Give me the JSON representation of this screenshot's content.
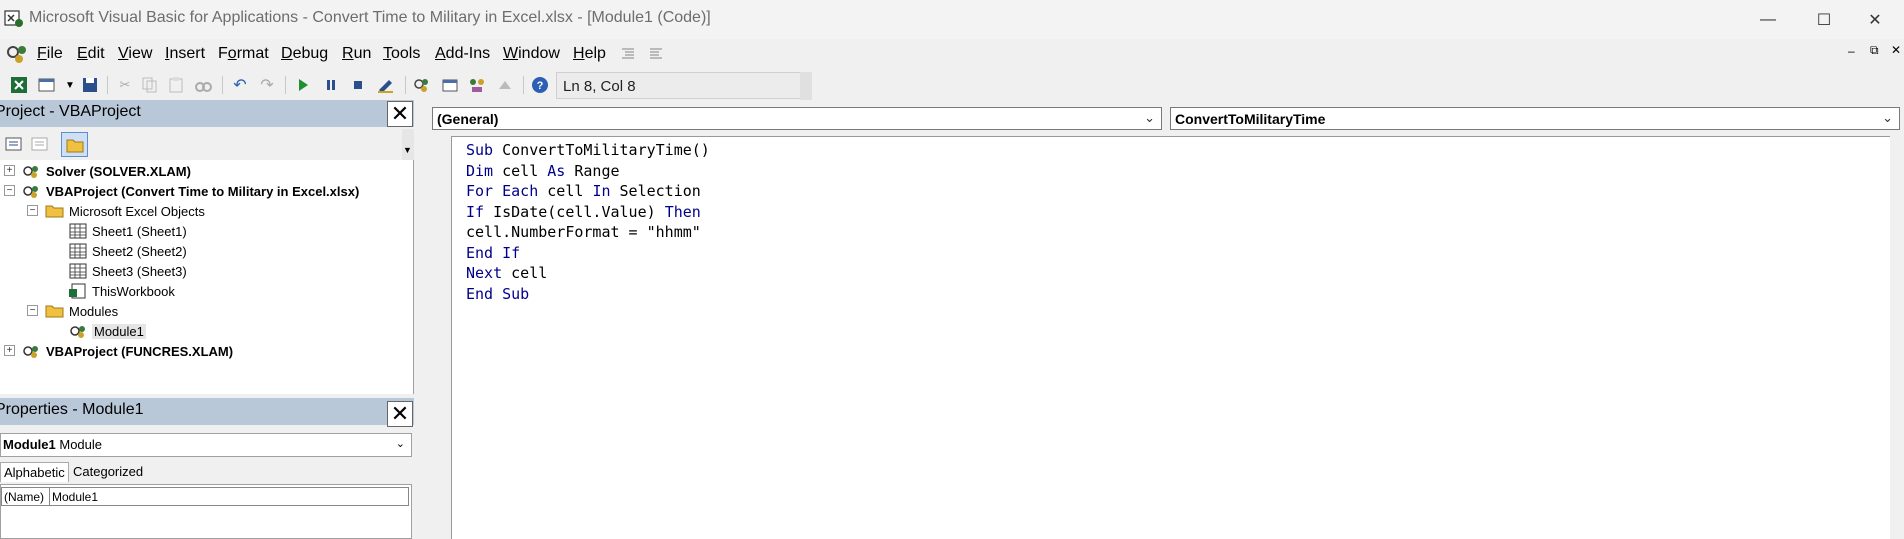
{
  "window": {
    "title": "Microsoft Visual Basic for Applications - Convert Time to Military in Excel.xlsx - [Module1 (Code)]",
    "controls": {
      "minimize": "—",
      "maximize": "☐",
      "close": "✕"
    }
  },
  "menu": {
    "items": [
      {
        "label": "File"
      },
      {
        "label": "Edit"
      },
      {
        "label": "View"
      },
      {
        "label": "Insert"
      },
      {
        "label": "Format"
      },
      {
        "label": "Debug"
      },
      {
        "label": "Run"
      },
      {
        "label": "Tools"
      },
      {
        "label": "Add-Ins"
      },
      {
        "label": "Window"
      },
      {
        "label": "Help"
      }
    ],
    "mdi": {
      "minimize": "–",
      "restore": "⧉",
      "close": "✕"
    }
  },
  "toolbar": {
    "cursor_position": "Ln 8, Col 8"
  },
  "project": {
    "title": "Project - VBAProject",
    "tree": {
      "solver": "Solver (SOLVER.XLAM)",
      "vbaproject": "VBAProject (Convert Time to Military in Excel.xlsx)",
      "excel_objects": "Microsoft Excel Objects",
      "sheet1": "Sheet1 (Sheet1)",
      "sheet2": "Sheet2 (Sheet2)",
      "sheet3": "Sheet3 (Sheet3)",
      "thisworkbook": "ThisWorkbook",
      "modules": "Modules",
      "module1": "Module1",
      "funcres": "VBAProject (FUNCRES.XLAM)"
    }
  },
  "properties": {
    "title": "Properties - Module1",
    "object_name": "Module1",
    "object_type": "Module",
    "tabs": {
      "alphabetic": "Alphabetic",
      "categorized": "Categorized"
    },
    "rows": [
      {
        "name": "(Name)",
        "value": "Module1"
      }
    ]
  },
  "code": {
    "object_combo": "(General)",
    "procedure_combo": "ConvertToMilitaryTime",
    "lines": [
      {
        "kw": "Sub",
        "rest": " ConvertToMilitaryTime()"
      },
      {
        "kw": "Dim",
        "rest": " cell ",
        "kw2": "As",
        "rest2": " Range"
      },
      {
        "kw": "For Each",
        "rest": " cell ",
        "kw2": "In",
        "rest2": " Selection"
      },
      {
        "kw": "If",
        "rest": " IsDate(cell.Value) ",
        "kw2": "Then",
        "rest2": ""
      },
      {
        "kw": "",
        "rest": "cell.NumberFormat = \"hhmm\""
      },
      {
        "kw": "End If",
        "rest": ""
      },
      {
        "kw": "Next",
        "rest": " cell"
      },
      {
        "kw": "End Sub",
        "rest": ""
      }
    ]
  }
}
